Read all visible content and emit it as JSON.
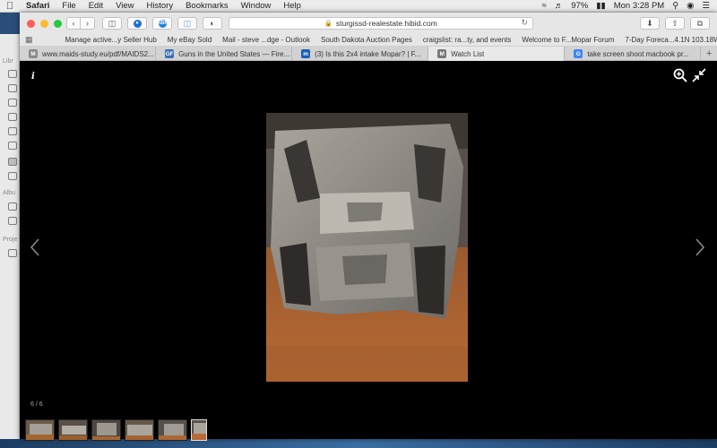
{
  "menubar": {
    "app": "Safari",
    "items": [
      "File",
      "Edit",
      "View",
      "History",
      "Bookmarks",
      "Window",
      "Help"
    ],
    "battery": "97%",
    "clock": "Mon 3:28 PM"
  },
  "sidebar": {
    "labels": [
      "Libr",
      "Albu",
      "Proje"
    ]
  },
  "browser": {
    "url": "sturgissd-realestate.hibid.com",
    "ext_badge": "ABP",
    "bookmarks": [
      "Manage active...y Seller Hub",
      "My eBay Sold",
      "Mail - steve ...dge - Outlook",
      "South Dakota Auction Pages",
      "craigslist: ra...ty, and events",
      "Welcome to F...Mopar Forum",
      "7-Day Foreca...4.1N 103.18W"
    ],
    "tabs": [
      {
        "favicon": "M",
        "title": "www.maids-study.eu/pdf/MAIDS2...",
        "color": "#8a8a8a"
      },
      {
        "favicon": "GF",
        "title": "Guns in the United States — Fire...",
        "color": "#3b6fb6"
      },
      {
        "favicon": "m",
        "title": "(3) Is this 2x4 intake Mopar? | F...",
        "color": "#1a5fb4"
      },
      {
        "favicon": "M",
        "title": "Watch List",
        "color": "#777777"
      },
      {
        "favicon": "G",
        "title": "take screen shoot macbook pr...",
        "color": "#4285f4"
      }
    ],
    "active_tab": 3,
    "add_tab": "+"
  },
  "viewer": {
    "info_label": "i",
    "counter": "6 / 6",
    "thumbnail_count": 6,
    "active_thumbnail": 6,
    "photo_subject": "cast aluminum 2x4 intake manifold on orange table"
  }
}
